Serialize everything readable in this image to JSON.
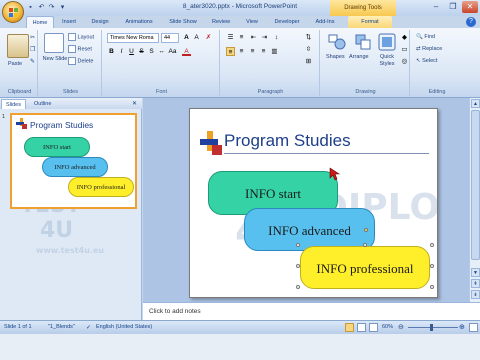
{
  "window": {
    "title": "8_ater3020.pptx - Microsoft PowerPoint",
    "contextual_tab_group": "Drawing Tools",
    "controls": [
      "–",
      "❐",
      "✕"
    ]
  },
  "tabs": [
    {
      "label": "Home"
    },
    {
      "label": "Insert"
    },
    {
      "label": "Design"
    },
    {
      "label": "Animations"
    },
    {
      "label": "Slide Show"
    },
    {
      "label": "Review"
    },
    {
      "label": "View"
    },
    {
      "label": "Developer"
    },
    {
      "label": "Add-Ins"
    },
    {
      "label": "Format"
    }
  ],
  "ribbon": {
    "clipboard": {
      "label": "Clipboard",
      "paste": "Paste"
    },
    "slides": {
      "label": "Slides",
      "new_slide": "New Slide",
      "layout": "Layout",
      "reset": "Reset",
      "delete": "Delete"
    },
    "font": {
      "label": "Font",
      "font_name": "Times New Roma",
      "font_size": "44"
    },
    "paragraph": {
      "label": "Paragraph"
    },
    "drawing": {
      "label": "Drawing",
      "shapes": "Shapes",
      "arrange": "Arrange",
      "quick_styles": "Quick Styles"
    },
    "editing": {
      "label": "Editing",
      "find": "Find",
      "replace": "Replace",
      "select": "Select"
    }
  },
  "left_pane": {
    "tab_slides": "Slides",
    "tab_outline": "Outline",
    "slide_number": "1"
  },
  "slide": {
    "title": "Program Studies",
    "shapes": [
      {
        "text": "INFO start",
        "color": "#35d2a6"
      },
      {
        "text": "INFO advanced",
        "color": "#58c0ee"
      },
      {
        "text": "INFO professional",
        "color": "#ffef2a"
      }
    ],
    "watermark_left": "TEST",
    "watermark_left2": "4U",
    "watermark_right": "DIPLOMA",
    "watermark_url": "www.test4u.eu"
  },
  "notes": {
    "placeholder": "Click to add notes"
  },
  "status": {
    "slide": "Slide 1 of 1",
    "theme": "\"1_Blends\"",
    "language": "English (United States)",
    "zoom": "60%"
  }
}
